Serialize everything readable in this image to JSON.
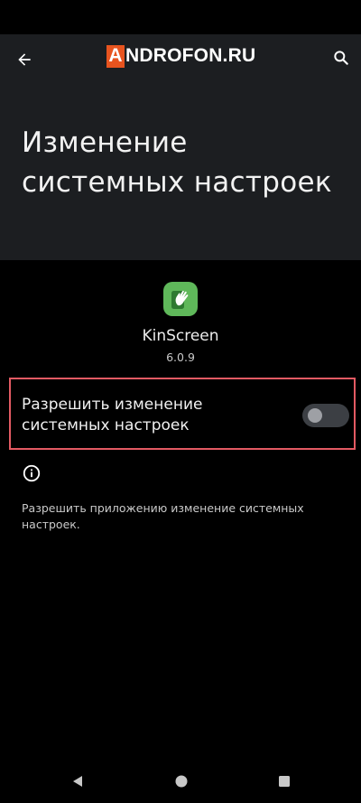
{
  "brand": {
    "first_letter": "A",
    "rest": "NDROFON.RU"
  },
  "header": {
    "title": "Изменение системных настроек"
  },
  "app": {
    "name": "KinScreen",
    "version": "6.0.9",
    "icon": "kinscreen-hand-icon"
  },
  "setting": {
    "label": "Разрешить изменение системных настроек",
    "enabled": false
  },
  "description": "Разрешить приложению изменение системных настроек.",
  "icons": {
    "back": "arrow-left-icon",
    "search": "search-icon",
    "info": "info-icon",
    "nav_back": "triangle-back-icon",
    "nav_home": "circle-home-icon",
    "nav_recents": "square-recents-icon"
  },
  "colors": {
    "header_bg": "#1c1e21",
    "highlight_border": "#e35a63",
    "brand_accent": "#e8541f",
    "app_icon_bg": "#5fb85a"
  }
}
